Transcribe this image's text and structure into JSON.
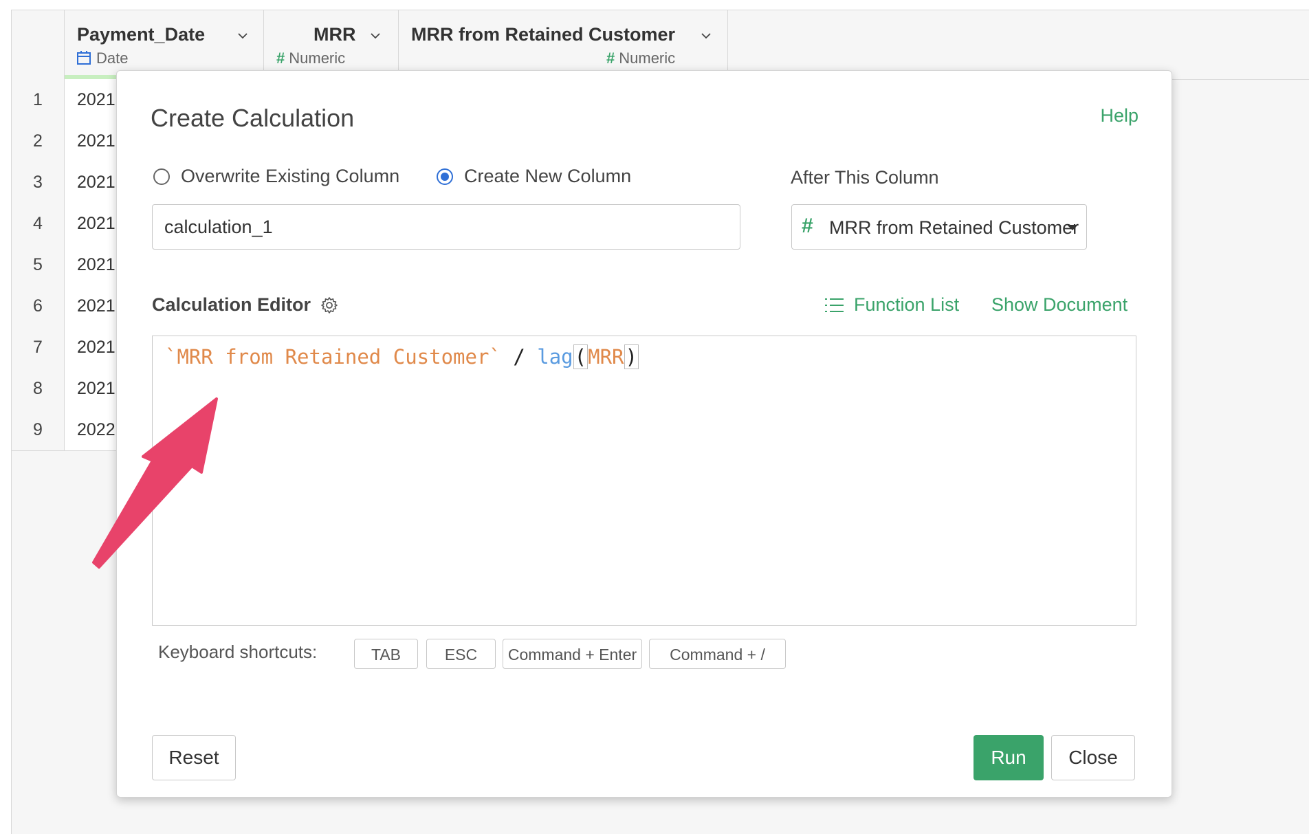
{
  "table": {
    "columns": [
      {
        "name": "Payment_Date",
        "type": "Date"
      },
      {
        "name": "MRR",
        "type": "Numeric"
      },
      {
        "name": "MRR from Retained Customer",
        "type": "Numeric"
      }
    ],
    "rows": [
      {
        "num": "1",
        "value": "2021"
      },
      {
        "num": "2",
        "value": "2021"
      },
      {
        "num": "3",
        "value": "2021"
      },
      {
        "num": "4",
        "value": "2021"
      },
      {
        "num": "5",
        "value": "2021"
      },
      {
        "num": "6",
        "value": "2021"
      },
      {
        "num": "7",
        "value": "2021"
      },
      {
        "num": "8",
        "value": "2021"
      },
      {
        "num": "9",
        "value": "2022"
      }
    ]
  },
  "dialog": {
    "title": "Create Calculation",
    "help": "Help",
    "option_overwrite": "Overwrite Existing Column",
    "option_create": "Create New Column",
    "selected_option": "create",
    "after_column_label": "After This Column",
    "column_name_value": "calculation_1",
    "after_column_value": "MRR from Retained Customer",
    "editor_label": "Calculation Editor",
    "function_list": "Function List",
    "show_document": "Show Document",
    "code": {
      "column_ref": "`MRR from Retained Customer`",
      "operator": " / ",
      "function": "lag",
      "open_paren": "(",
      "arg": "MRR",
      "close_paren": ")"
    },
    "keyboard_label": "Keyboard shortcuts:",
    "shortcuts": [
      "TAB",
      "ESC",
      "Command + Enter",
      "Command + /"
    ],
    "reset": "Reset",
    "run": "Run",
    "close": "Close"
  },
  "colors": {
    "accent_green": "#3aa36a",
    "radio_blue": "#2f6fd6",
    "string_orange": "#e0894a",
    "function_blue": "#5a9be0",
    "arrow_pink": "#e8436a"
  }
}
